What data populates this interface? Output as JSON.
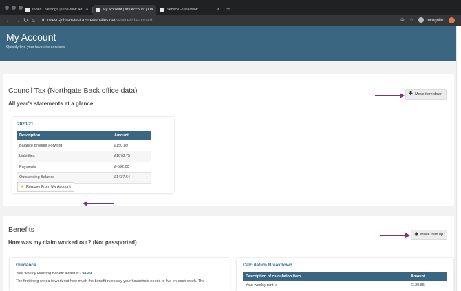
{
  "browser": {
    "tabs": [
      {
        "title": "Index | Settings | OneView Ad..."
      },
      {
        "title": "My Account | My Account | On..."
      },
      {
        "title": "Service - OneView"
      }
    ],
    "url_host": "onevu-john-m-test.azurewebsites.net",
    "url_path": "/service#/dashboard",
    "incognito_label": "Incognito"
  },
  "header": {
    "title": "My Account",
    "subtitle": "Quickly find your favourite services."
  },
  "council_tax": {
    "title": "Council Tax (Northgate Back office data)",
    "subtitle": "All year's statements at a glance",
    "move_label": "Move item down",
    "card": {
      "year": "2020/21",
      "columns": [
        "Description",
        "Amount"
      ],
      "rows": [
        {
          "description": "Balance Brought Forward",
          "amount": "£150.89"
        },
        {
          "description": "Liabilities",
          "amount": "£1878.75"
        },
        {
          "description": "Payments",
          "amount": "£-592.00"
        },
        {
          "description": "Outstanding Balance",
          "amount": "£1437.64"
        }
      ],
      "remove_label": "Remove From My Account"
    }
  },
  "benefits": {
    "title": "Benefits",
    "subtitle": "How was my claim worked out? (Not passported)",
    "move_label": "Move item up",
    "guidance": {
      "title": "Guidance",
      "line1_prefix": "Your weekly Housing Benefit award is ",
      "line1_amount": "£94.49",
      "line2": "The first thing we do is work out how much the benefit rules say your household needs to live on each week. The"
    },
    "calculation": {
      "title": "Calculation Breakdown",
      "columns": [
        "Description of calculation item",
        "Amount"
      ],
      "rows": [
        {
          "description": "Your weekly rent is",
          "amount": "£120.85"
        }
      ]
    }
  },
  "colors": {
    "header_bg": "#3a6682",
    "accent_link": "#2f6a96",
    "annotation_arrow": "#7b2f8f",
    "star": "#e2a21b"
  }
}
